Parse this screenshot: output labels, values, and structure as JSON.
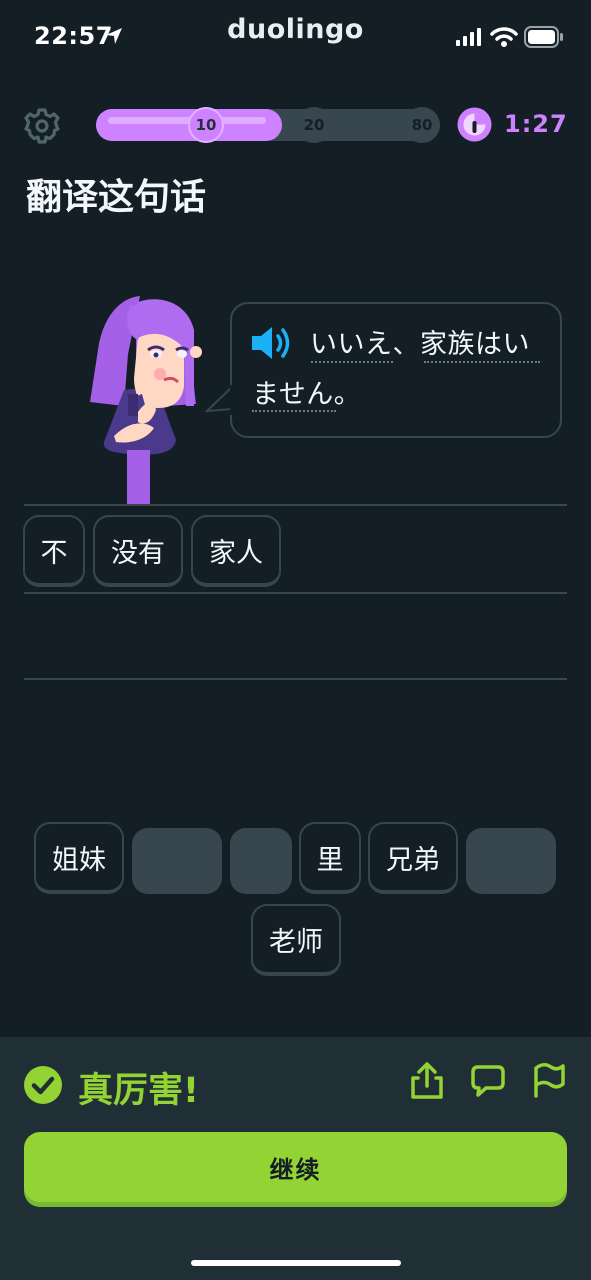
{
  "status_bar": {
    "time": "22:57",
    "app_brand": "duolingo"
  },
  "header": {
    "progress": {
      "fraction": 0.54,
      "milestones": [
        "10",
        "20",
        "80"
      ],
      "reached": [
        "10"
      ]
    },
    "timer": "1:27"
  },
  "prompt": {
    "title": "翻译这句话"
  },
  "bubble": {
    "line1": "いいえ、家族はい",
    "line2": "ません。"
  },
  "answer_chips": [
    "不",
    "没有",
    "家人"
  ],
  "word_bank": {
    "row1": [
      {
        "label": "姐妹",
        "used": false
      },
      {
        "label": "",
        "used": true
      },
      {
        "label": "",
        "used": true
      },
      {
        "label": "里",
        "used": false
      },
      {
        "label": "兄弟",
        "used": false
      },
      {
        "label": "",
        "used": true
      }
    ],
    "row2": [
      {
        "label": "老师",
        "used": false
      }
    ]
  },
  "footer": {
    "feedback": "真厉害!",
    "continue_label": "继续"
  },
  "colors": {
    "background": "#131f24",
    "accent_purple": "#ce82ff",
    "success_green": "#93d333",
    "border": "#37464f",
    "footer_bg": "#202f36",
    "speaker_blue": "#1cb0f6"
  },
  "icons": [
    "location-arrow-icon",
    "signal-icon",
    "wifi-icon",
    "battery-icon",
    "gear-icon",
    "timer-icon",
    "speaker-icon",
    "check-circle-icon",
    "share-icon",
    "comment-icon",
    "flag-icon"
  ]
}
